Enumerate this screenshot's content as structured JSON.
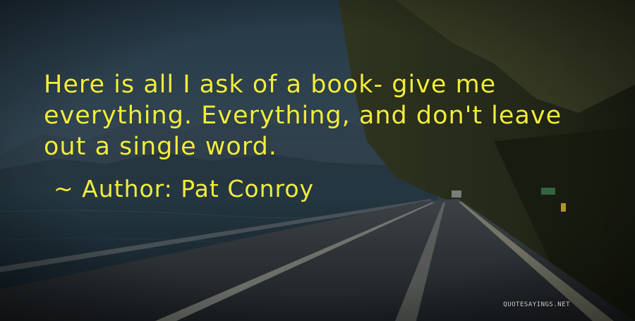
{
  "quote": {
    "text": "Here is all I ask of a book- give me\neverything. Everything, and don't leave\nout a single word.",
    "author_line": "~ Author: Pat Conroy",
    "color": "#f1ec3c"
  },
  "watermark": {
    "text": "QUOTESAYINGS.NET"
  }
}
